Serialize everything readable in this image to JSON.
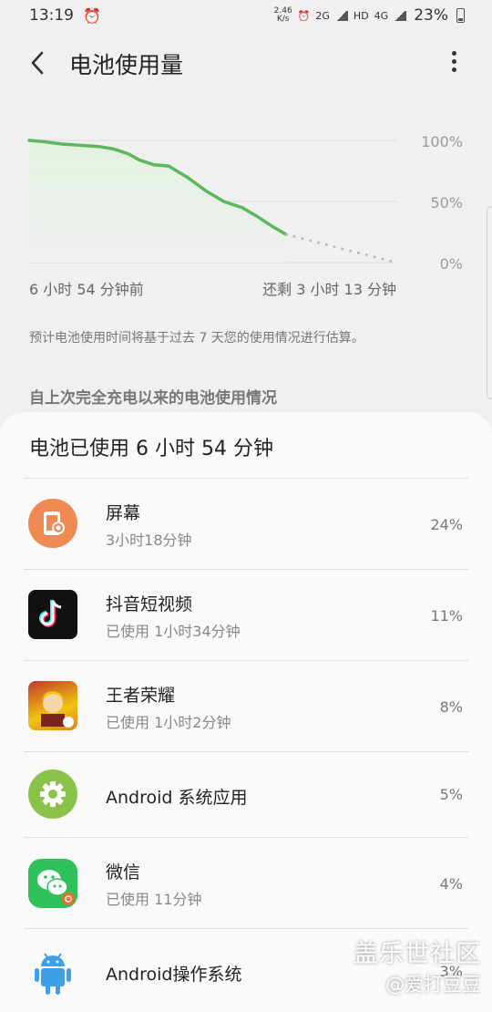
{
  "status_bar": {
    "time": "13:19",
    "alarm_icon": "alarm-icon",
    "net_speed_value": "2.46",
    "net_speed_unit": "K/s",
    "network_2g": "2G",
    "hd_label": "HD",
    "network_4g": "4G",
    "battery_percent": "23%"
  },
  "header": {
    "title": "电池使用量",
    "back_icon": "back-arrow-icon",
    "more_icon": "more-vert-icon"
  },
  "chart_data": {
    "type": "line",
    "x_left_label": "6 小时 54 分钟前",
    "x_right_label": "还剩 3 小时 13 分钟",
    "y_ticks": [
      "100%",
      "50%",
      "0%"
    ],
    "ylim": [
      0,
      100
    ],
    "series": [
      {
        "style": "solid",
        "color": "#5cb85c",
        "x": [
          0,
          0.04,
          0.09,
          0.14,
          0.19,
          0.23,
          0.27,
          0.3,
          0.34,
          0.38,
          0.43,
          0.48,
          0.53,
          0.58,
          0.62,
          0.66,
          0.7
        ],
        "values": [
          100,
          99,
          97,
          96,
          95,
          93,
          89,
          84,
          80,
          79,
          70,
          59,
          50,
          45,
          38,
          30,
          23
        ]
      },
      {
        "style": "dotted",
        "color": "#bbbbbb",
        "x": [
          0.7,
          1.0
        ],
        "values": [
          23,
          0
        ]
      }
    ],
    "fill_color": "#e3f2e1"
  },
  "note": "预计电池使用时间将基于过去 7 天您的使用情况进行估算。",
  "section_heading": "自上次完全充电以来的电池使用情况",
  "card": {
    "title": "电池已使用 6 小时 54 分钟",
    "items": [
      {
        "name": "屏幕",
        "sub": "3小时18分钟",
        "percent": "24%",
        "icon": "screen-brightness-icon"
      },
      {
        "name": "抖音短视频",
        "sub": "已使用 1小时34分钟",
        "percent": "11%",
        "icon": "douyin-app-icon"
      },
      {
        "name": "王者荣耀",
        "sub": "已使用 1小时2分钟",
        "percent": "8%",
        "icon": "honor-of-kings-app-icon"
      },
      {
        "name": "Android 系统应用",
        "sub": "",
        "percent": "5%",
        "icon": "android-gear-icon"
      },
      {
        "name": "微信",
        "sub": "已使用 11分钟",
        "percent": "4%",
        "icon": "wechat-app-icon"
      },
      {
        "name": "Android操作系统",
        "sub": "",
        "percent": "3%",
        "icon": "android-robot-icon"
      }
    ]
  },
  "watermark": {
    "line1": "盖乐世社区",
    "line2": "@爱打豆豆"
  }
}
